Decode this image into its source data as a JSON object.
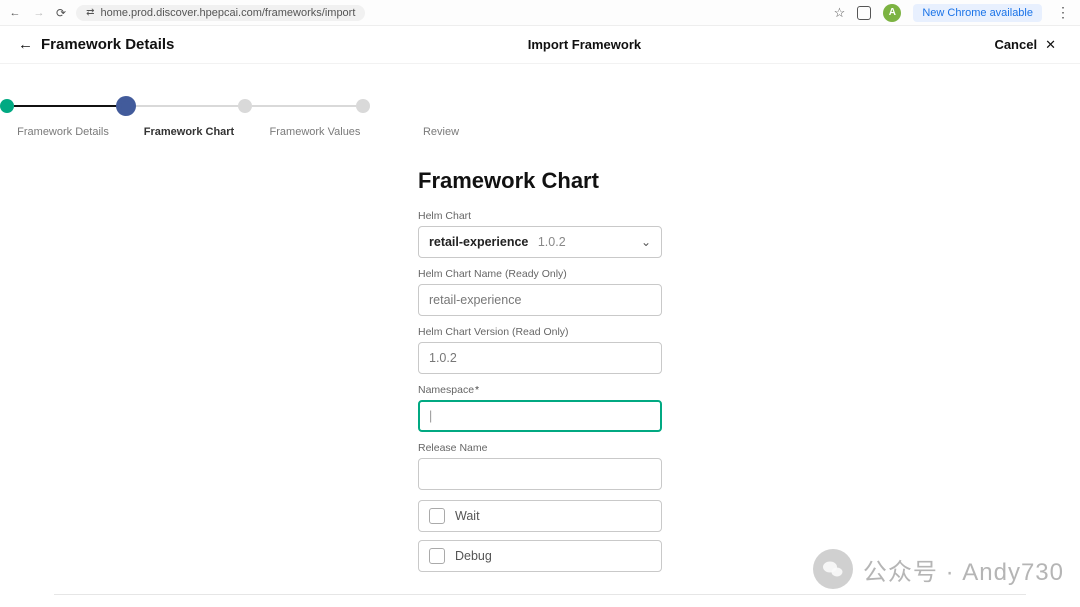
{
  "browser": {
    "url": "home.prod.discover.hpepcai.com/frameworks/import",
    "avatar_initial": "A",
    "update_button": "New Chrome available"
  },
  "header": {
    "back_label": "Framework Details",
    "center_title": "Import Framework",
    "cancel_label": "Cancel"
  },
  "stepper": {
    "steps": [
      {
        "label": "Framework Details",
        "state": "done"
      },
      {
        "label": "Framework Chart",
        "state": "active"
      },
      {
        "label": "Framework Values",
        "state": "todo"
      },
      {
        "label": "Review",
        "state": "todo"
      }
    ]
  },
  "form": {
    "title": "Framework Chart",
    "fields": {
      "helm_chart_label": "Helm Chart",
      "helm_chart_selected_name": "retail-experience",
      "helm_chart_selected_version": "1.0.2",
      "helm_chart_name_label": "Helm Chart Name (Ready Only)",
      "helm_chart_name_value": "retail-experience",
      "helm_chart_version_label": "Helm Chart Version (Read Only)",
      "helm_chart_version_value": "1.0.2",
      "namespace_label": "Namespace",
      "namespace_value": "",
      "release_name_label": "Release Name",
      "release_name_value": "",
      "wait_label": "Wait",
      "debug_label": "Debug"
    }
  },
  "watermark": {
    "text": "公众号 · Andy730"
  }
}
